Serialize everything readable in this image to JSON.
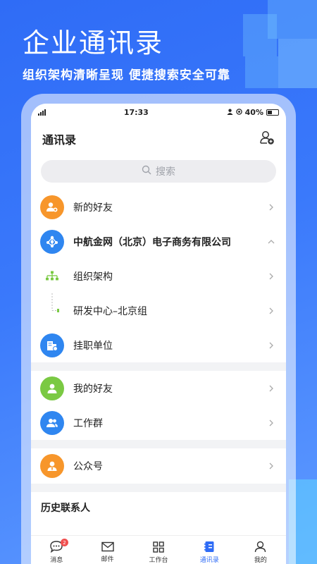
{
  "hero": {
    "title": "企业通讯录",
    "subtitle": "组织架构清晰呈现  便捷搜索安全可靠"
  },
  "statusbar": {
    "time": "17:33",
    "battery": "40%"
  },
  "header": {
    "title": "通讯录",
    "add_icon": "add-contact-icon"
  },
  "search": {
    "placeholder": "搜索"
  },
  "rows": {
    "new_friends": "新的好友",
    "company": "中航金网（北京）电子商务有限公司",
    "org_structure": "组织架构",
    "dept": "研发中心–北京组",
    "affiliated": "挂职单位",
    "my_friends": "我的好友",
    "work_groups": "工作群",
    "official_accounts": "公众号"
  },
  "history": {
    "title": "历史联系人"
  },
  "tabbar": {
    "messages": "消息",
    "messages_badge": "2",
    "mail": "邮件",
    "workbench": "工作台",
    "contacts": "通讯录",
    "me": "我的"
  },
  "colors": {
    "orange": "#f7962b",
    "blue": "#2f86f0",
    "green": "#7ac943",
    "accent": "#2f6cf6"
  }
}
